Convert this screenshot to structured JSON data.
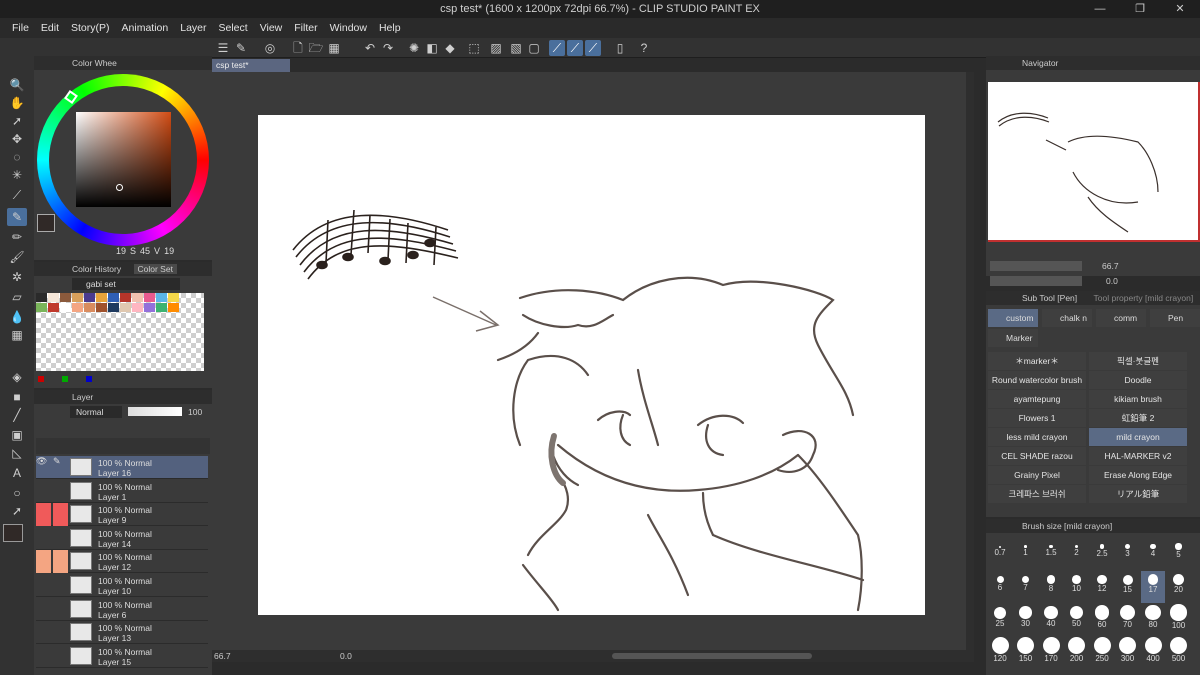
{
  "window": {
    "title": "csp test* (1600 x 1200px 72dpi 66.7%)  - CLIP STUDIO PAINT EX",
    "min": "—",
    "max": "❐",
    "close": "✕"
  },
  "menu": [
    "File",
    "Edit",
    "Story(P)",
    "Animation",
    "Layer",
    "Select",
    "View",
    "Filter",
    "Window",
    "Help"
  ],
  "document_tab": "csp test*",
  "color_wheel": {
    "tab": "Color Whee",
    "values": [
      "19",
      "S",
      "45",
      "V",
      "19"
    ],
    "hue_color": "#c45a2a"
  },
  "color_set": {
    "tabs": [
      "Color History",
      "Color Set"
    ],
    "set_name": "gabi set"
  },
  "layer_panel": {
    "tab": "Layer",
    "blend": "Normal",
    "opacity": "100",
    "layers": [
      {
        "pct": "100 % Normal",
        "name": "Layer 16",
        "sel": true,
        "mark": ""
      },
      {
        "pct": "100 % Normal",
        "name": "Layer 1",
        "sel": false,
        "mark": ""
      },
      {
        "pct": "100 % Normal",
        "name": "Layer 9",
        "sel": false,
        "mark": "#f05a5a"
      },
      {
        "pct": "100 % Normal",
        "name": "Layer 14",
        "sel": false,
        "mark": ""
      },
      {
        "pct": "100 % Normal",
        "name": "Layer 12",
        "sel": false,
        "mark": "#f4a582"
      },
      {
        "pct": "100 % Normal",
        "name": "Layer 10",
        "sel": false,
        "mark": ""
      },
      {
        "pct": "100 % Normal",
        "name": "Layer 6",
        "sel": false,
        "mark": ""
      },
      {
        "pct": "100 % Normal",
        "name": "Layer 13",
        "sel": false,
        "mark": ""
      },
      {
        "pct": "100 % Normal",
        "name": "Layer 15",
        "sel": false,
        "mark": ""
      }
    ]
  },
  "navigator": {
    "tab": "Navigator",
    "zoom": "66.7",
    "rotate": "0.0"
  },
  "subtool": {
    "tab": "Sub Tool [Pen]",
    "tab2": "Tool property [mild crayon]",
    "groups": [
      "custom",
      "chalk n",
      "comm",
      "Pen",
      "Marker"
    ],
    "brushes": [
      [
        "＊marker＊",
        "픽셀·붓글펜"
      ],
      [
        "Round watercolor brush",
        "Doodle"
      ],
      [
        "ayamtepung",
        "kikiam brush"
      ],
      [
        "Flowers 1",
        "虹鉛筆 2"
      ],
      [
        "less mild crayon",
        "mild crayon"
      ],
      [
        "CEL SHADE razou",
        "HAL-MARKER v2"
      ],
      [
        "Grainy Pixel",
        "Erase Along Edge"
      ],
      [
        "크레파스 브러쉬",
        "リアル鉛筆"
      ]
    ]
  },
  "brush_size": {
    "tab": "Brush size [mild crayon]",
    "sizes": [
      "0.7",
      "1",
      "1.5",
      "2",
      "2.5",
      "3",
      "4",
      "5",
      "6",
      "7",
      "8",
      "10",
      "12",
      "15",
      "17",
      "20",
      "25",
      "30",
      "40",
      "50",
      "60",
      "70",
      "80",
      "100",
      "120",
      "150",
      "170",
      "200",
      "250",
      "300",
      "400",
      "500"
    ],
    "selected": "17"
  },
  "status": {
    "zoom": "66.7",
    "rotate": "0.0"
  }
}
